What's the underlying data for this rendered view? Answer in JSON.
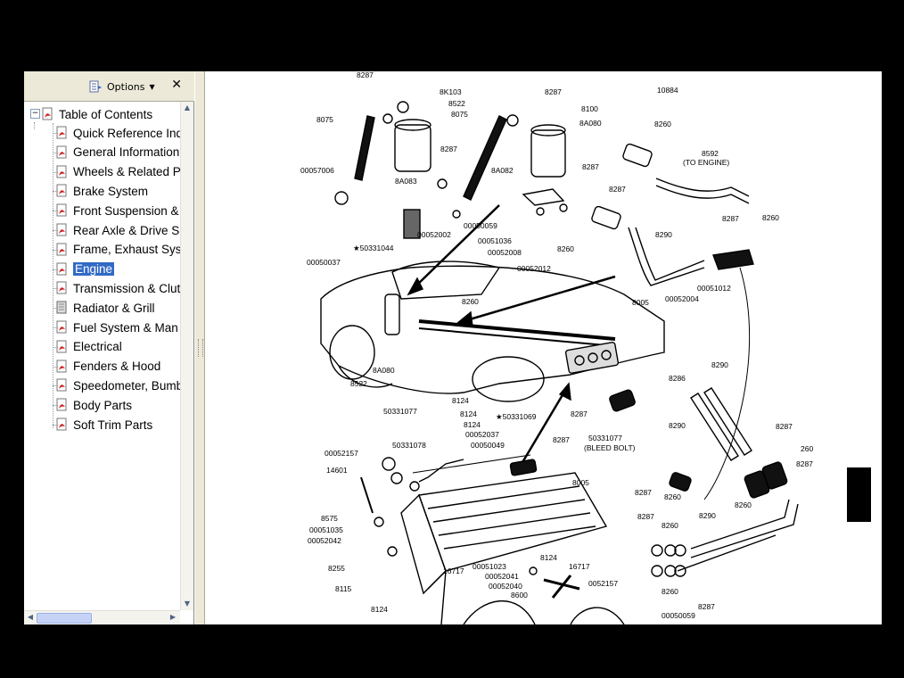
{
  "panel": {
    "options_label": "Options",
    "close_glyph": "✕",
    "options_icon": "options-icon"
  },
  "tree": {
    "root": {
      "label": "Table of Contents",
      "expander": "−"
    },
    "items": [
      {
        "label": "Quick Reference Ind",
        "icon": "pdf-bookmark-icon"
      },
      {
        "label": "General Information",
        "icon": "pdf-bookmark-icon"
      },
      {
        "label": "Wheels & Related P",
        "icon": "pdf-bookmark-icon"
      },
      {
        "label": "Brake System",
        "icon": "pdf-bookmark-icon"
      },
      {
        "label": "Front Suspension &",
        "icon": "pdf-bookmark-icon"
      },
      {
        "label": "Rear Axle & Drive Sl",
        "icon": "pdf-bookmark-icon"
      },
      {
        "label": "Frame, Exhaust Sys",
        "icon": "pdf-bookmark-icon"
      },
      {
        "label": "Engine",
        "icon": "pdf-bookmark-icon",
        "selected": true
      },
      {
        "label": "Transmission & Clut",
        "icon": "pdf-bookmark-icon"
      },
      {
        "label": "Radiator & Grill",
        "icon": "page-icon"
      },
      {
        "label": "Fuel System & Man",
        "icon": "pdf-bookmark-icon"
      },
      {
        "label": "Electrical",
        "icon": "pdf-bookmark-icon"
      },
      {
        "label": "Fenders & Hood",
        "icon": "pdf-bookmark-icon"
      },
      {
        "label": "Speedometer, Bumb",
        "icon": "pdf-bookmark-icon"
      },
      {
        "label": "Body Parts",
        "icon": "pdf-bookmark-icon"
      },
      {
        "label": "Soft Trim Parts",
        "icon": "pdf-bookmark-icon"
      }
    ]
  },
  "diagram": {
    "part_labels": {
      "l8287a": "8287",
      "l8K103": "8K103",
      "l8522a": "8522",
      "l8075a": "8075",
      "l8075b": "8075",
      "l8287b": "8287",
      "l8100": "8100",
      "l8A080a": "8A080",
      "l10884": "10884",
      "l8260a": "8260",
      "l8592": "8592",
      "lToEngine": "(TO ENGINE)",
      "l00057006": "00057006",
      "l8287c": "8287",
      "l8A083": "8A083",
      "l8A082": "8A082",
      "l8287d": "8287",
      "l8287e": "8287",
      "l8260b": "8260",
      "l00050059a": "00050059",
      "l00052002": "00052002",
      "l00051036": "00051036",
      "l00052008": "00052008",
      "l8260c": "8260",
      "l8290a": "8290",
      "l00050037": "00050037",
      "l50331044": "★50331044",
      "l00052012": "00052012",
      "l00051012": "00051012",
      "l00052004": "00052004",
      "l8260d": "8260",
      "l8005a": "8005",
      "l8A080b": "8A080",
      "l8522b": "8522",
      "l8286": "8286",
      "l8290b": "8290",
      "l8124a": "8124",
      "l50331077a": "50331077",
      "l8124b": "8124",
      "l8124c": "8124",
      "l50331069": "★50331069",
      "l8287f": "8287",
      "l8290c": "8290",
      "l00052037": "00052037",
      "l00050049": "00050049",
      "l8287g": "8287",
      "l50331077b": "50331077",
      "lBleedBolt": "(BLEED BOLT)",
      "l00052157a": "00052157",
      "l50331078": "50331078",
      "l8287h": "8287",
      "l260": "260",
      "l8287i": "8287",
      "l14601": "14601",
      "l8005b": "8005",
      "l8287j": "8287",
      "l8260e": "8260",
      "l8260f": "8260",
      "l8575": "8575",
      "l00051035": "00051035",
      "l00052042": "00052042",
      "l8287k": "8287",
      "l8260g": "8260",
      "l8290d": "8290",
      "l8255": "8255",
      "l8124d": "8124",
      "l16717a": "16717",
      "l00051023": "00051023",
      "l16717b": "16717",
      "l8115": "8115",
      "l00052041": "00052041",
      "l00052040": "00052040",
      "l0052157": "0052157",
      "l8260h": "8260",
      "l8600": "8600",
      "l8287l": "8287",
      "l8124e": "8124",
      "l00050059b": "00050059"
    },
    "section_tab_color": "#000000"
  }
}
